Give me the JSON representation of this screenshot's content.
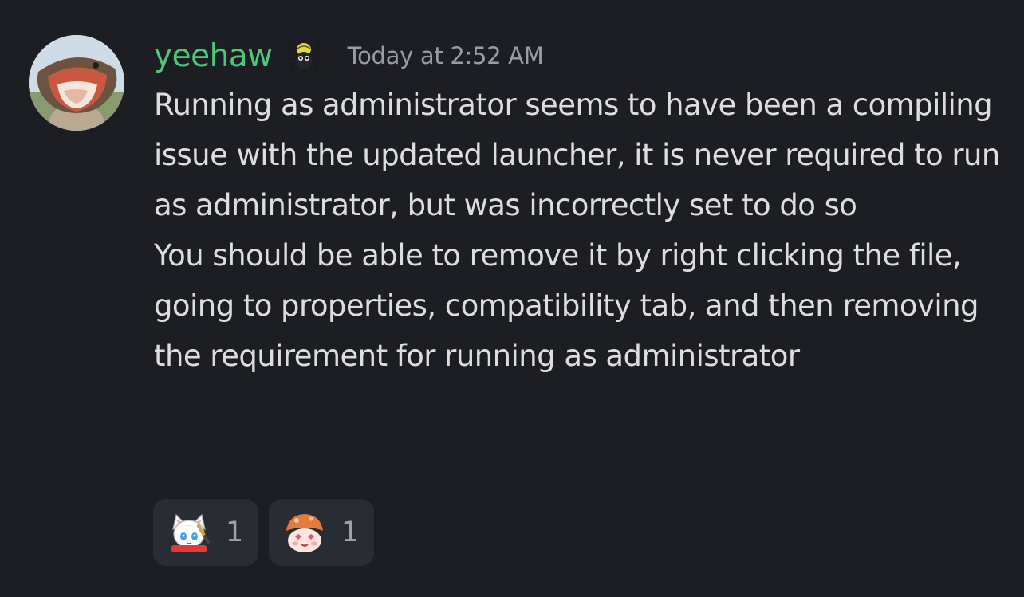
{
  "message": {
    "author": "yeehaw",
    "author_color": "#4fc77a",
    "role_icon": "spider-icon",
    "timestamp": "Today at 2:52 AM",
    "paragraphs": [
      "Running as administrator seems to have been a compiling issue with the updated launcher, it is never required to run as administrator, but was incorrectly set to do so",
      "You should be able to remove it by right clicking the file, going to properties, compatibility tab, and then removing the requirement for running as administrator"
    ],
    "avatar_icon": "ostrich-avatar"
  },
  "reactions": [
    {
      "emoji": "white-cat-girl-emoji",
      "count": "1"
    },
    {
      "emoji": "mushroom-blush-emoji",
      "count": "1"
    }
  ]
}
